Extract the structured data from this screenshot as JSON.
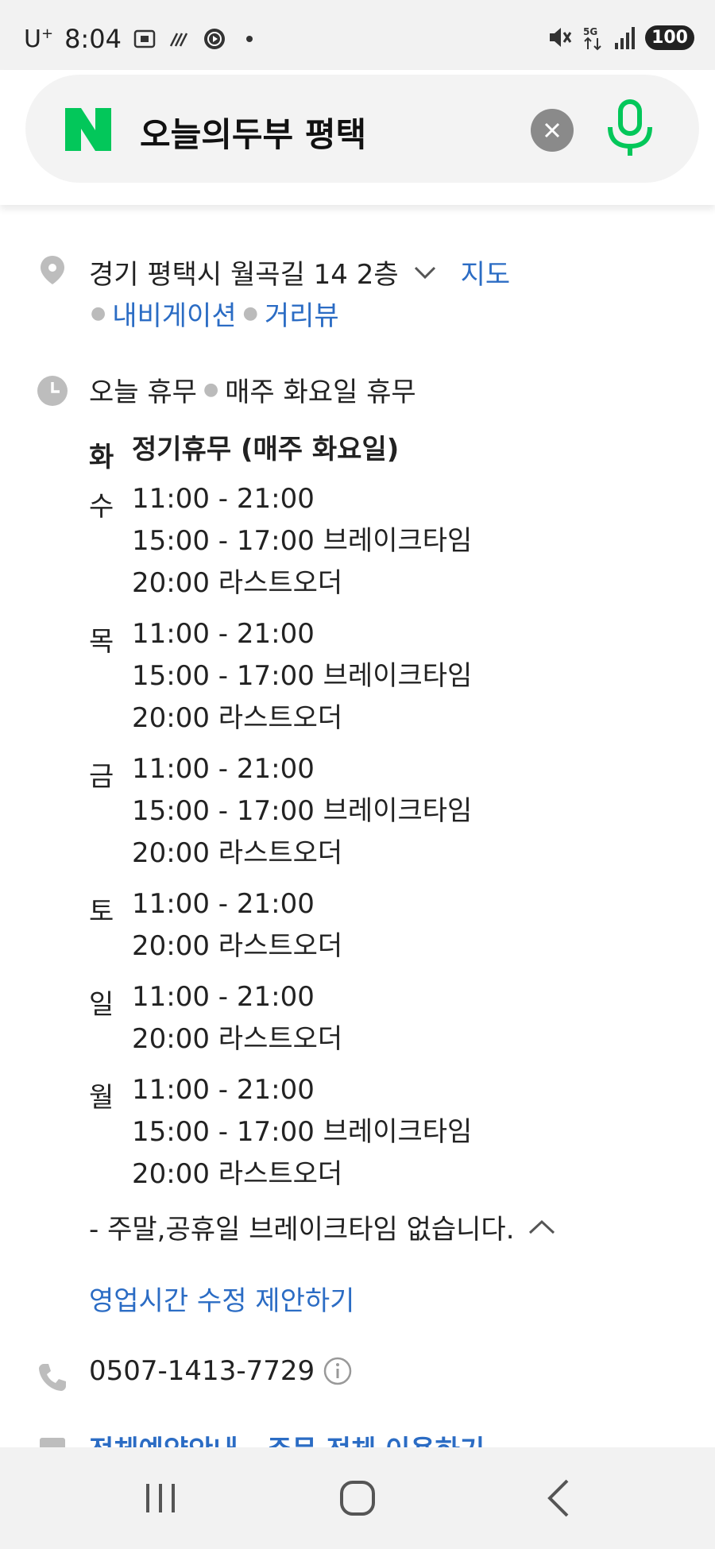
{
  "status_bar": {
    "carrier": "U",
    "carrier_sup": "+",
    "time": "8:04",
    "network": "5G",
    "battery": "100",
    "icons": [
      "screenshot-icon",
      "wifi-calling-icon",
      "media-play-icon",
      "notification-dot-icon",
      "mute-icon",
      "signal-icon"
    ]
  },
  "search": {
    "logo": "N",
    "query": "오늘의두부 평택",
    "clear_icon": "close-icon",
    "mic_icon": "microphone-icon",
    "brand_color": "#03c75a"
  },
  "address": {
    "text": "경기 평택시 월곡길 14 2층",
    "map_label": "지도",
    "links": [
      "내비게이션",
      "거리뷰"
    ]
  },
  "status": {
    "today": "오늘 휴무",
    "weekly": "매주 화요일 휴무"
  },
  "schedule": [
    {
      "day": "화",
      "lines": [
        "정기휴무 (매주 화요일)"
      ]
    },
    {
      "day": "수",
      "lines": [
        "11:00 - 21:00",
        "15:00 - 17:00 브레이크타임",
        "20:00 라스트오더"
      ]
    },
    {
      "day": "목",
      "lines": [
        "11:00 - 21:00",
        "15:00 - 17:00 브레이크타임",
        "20:00 라스트오더"
      ]
    },
    {
      "day": "금",
      "lines": [
        "11:00 - 21:00",
        "15:00 - 17:00 브레이크타임",
        "20:00 라스트오더"
      ]
    },
    {
      "day": "토",
      "lines": [
        "11:00 - 21:00",
        "20:00 라스트오더"
      ]
    },
    {
      "day": "일",
      "lines": [
        "11:00 - 21:00",
        "20:00 라스트오더"
      ]
    },
    {
      "day": "월",
      "lines": [
        "11:00 - 21:00",
        "15:00 - 17:00 브레이크타임",
        "20:00 라스트오더"
      ]
    }
  ],
  "note": "- 주말,공휴일 브레이크타임 없습니다.",
  "suggest_edit": "영업시간 수정 제안하기",
  "phone": "0507-1413-7729",
  "cutoff_text": "전체예약안내 · 주문 전체 이용하기",
  "accent_color": "#2b6cc4"
}
